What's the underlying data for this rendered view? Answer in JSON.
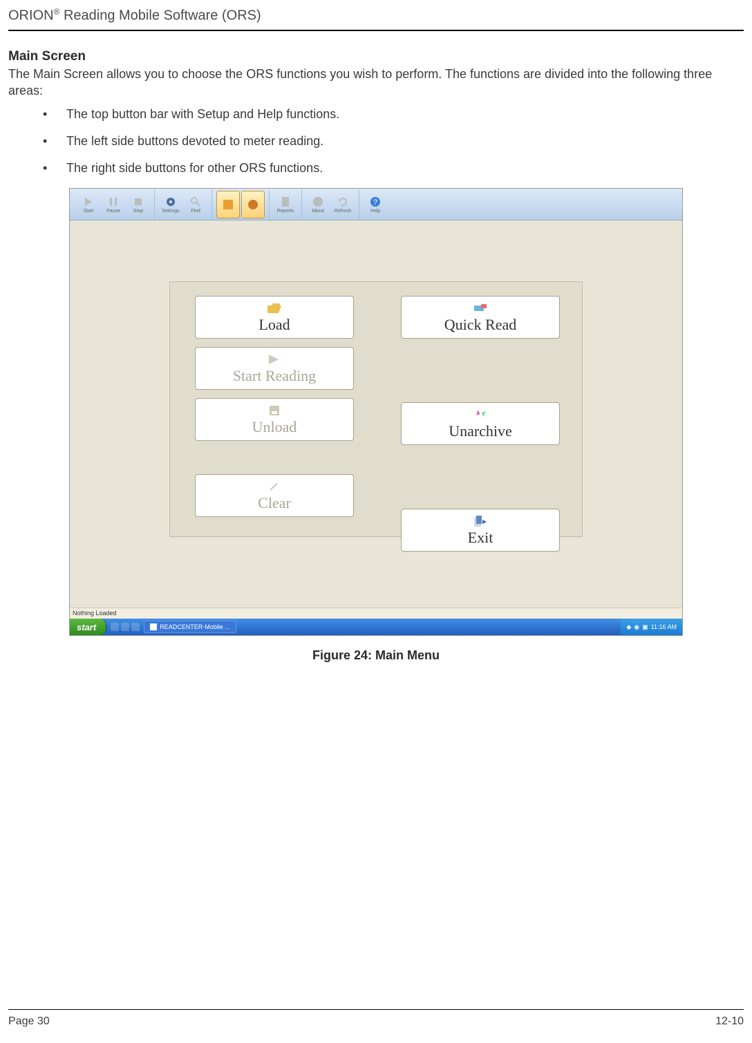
{
  "doc_header": "ORION® Reading Mobile Software (ORS)",
  "section_title": "Main Screen",
  "intro": "The Main Screen allows you to choose the ORS functions you wish to perform. The functions are divided into the following three areas:",
  "bullets": [
    "The top button bar with Setup and Help functions.",
    "The left side buttons devoted to meter reading.",
    "The right side buttons for other ORS functions."
  ],
  "screenshot": {
    "toolbar": {
      "items": [
        {
          "name": "start",
          "label": "Start"
        },
        {
          "name": "pause",
          "label": "Pause"
        },
        {
          "name": "stop",
          "label": "Stop"
        },
        {
          "name": "settings",
          "label": "Settings"
        },
        {
          "name": "find",
          "label": "Find"
        },
        {
          "name": "a1",
          "label": ""
        },
        {
          "name": "a2",
          "label": ""
        },
        {
          "name": "reports",
          "label": "Reports"
        },
        {
          "name": "about",
          "label": "About"
        },
        {
          "name": "refresh",
          "label": "Refresh"
        },
        {
          "name": "help",
          "label": "Help"
        }
      ]
    },
    "buttons": {
      "left": [
        {
          "key": "load",
          "label": "Load",
          "enabled": true
        },
        {
          "key": "start_reading",
          "label": "Start Reading",
          "enabled": false
        },
        {
          "key": "unload",
          "label": "Unload",
          "enabled": false
        },
        {
          "key": "clear",
          "label": "Clear",
          "enabled": false
        }
      ],
      "right": [
        {
          "key": "quick_read",
          "label": "Quick Read",
          "enabled": true
        },
        {
          "key": "unarchive",
          "label": "Unarchive",
          "enabled": true
        },
        {
          "key": "exit",
          "label": "Exit",
          "enabled": true
        }
      ]
    },
    "status": "Nothing Loaded",
    "taskbar": {
      "start": "start",
      "task1": "READCENTER-Mobile ...",
      "tray_time": "11:16 AM"
    }
  },
  "figure_caption": "Figure 24: Main Menu",
  "footer_left": "Page 30",
  "footer_right": "12-10"
}
